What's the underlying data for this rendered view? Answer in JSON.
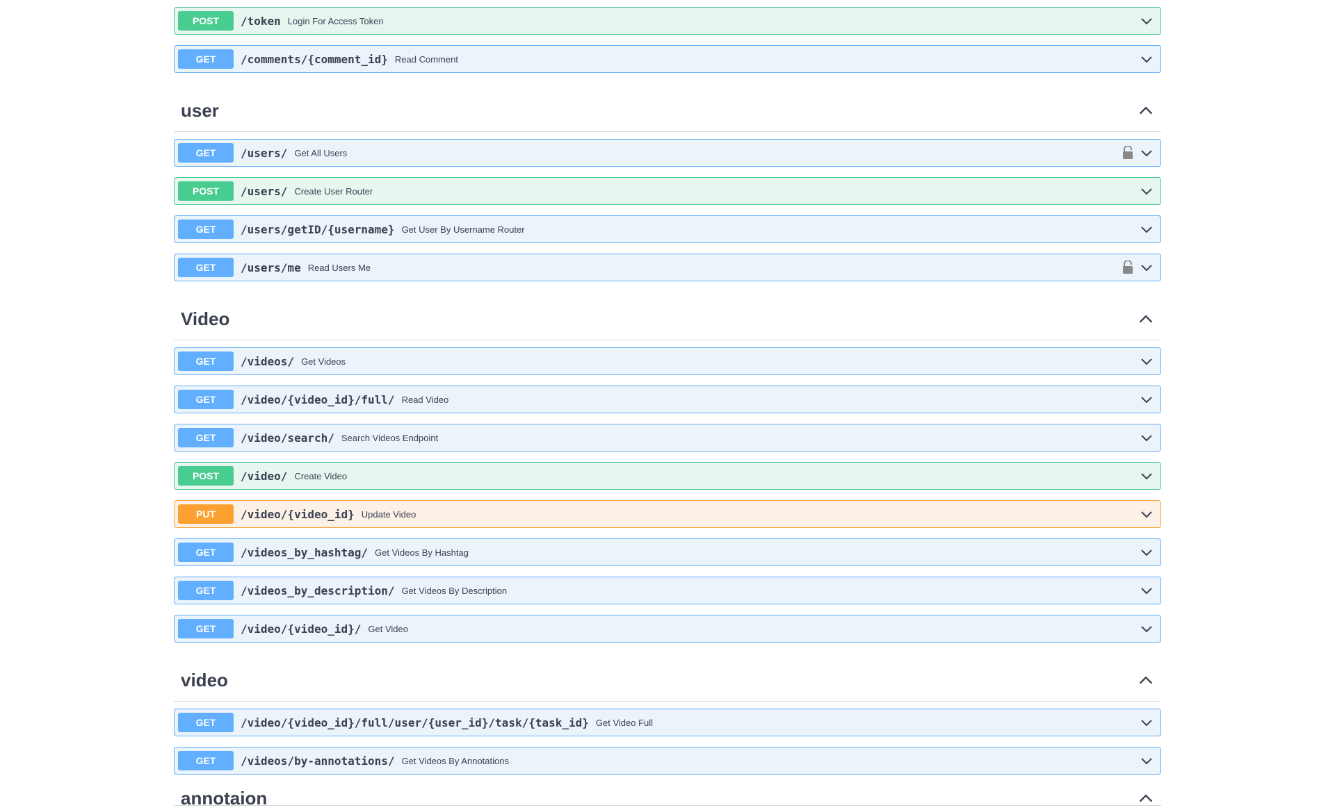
{
  "top_ops": [
    {
      "method": "POST",
      "type": "post",
      "path": "/token",
      "summary": "Login For Access Token",
      "lock": false
    },
    {
      "method": "GET",
      "type": "get",
      "path": "/comments/{comment_id}",
      "summary": "Read Comment",
      "lock": false
    }
  ],
  "sections": [
    {
      "title": "user",
      "ops": [
        {
          "method": "GET",
          "type": "get",
          "path": "/users/",
          "summary": "Get All Users",
          "lock": true
        },
        {
          "method": "POST",
          "type": "post",
          "path": "/users/",
          "summary": "Create User Router",
          "lock": false
        },
        {
          "method": "GET",
          "type": "get",
          "path": "/users/getID/{username}",
          "summary": "Get User By Username Router",
          "lock": false
        },
        {
          "method": "GET",
          "type": "get",
          "path": "/users/me",
          "summary": "Read Users Me",
          "lock": true
        }
      ]
    },
    {
      "title": "Video",
      "ops": [
        {
          "method": "GET",
          "type": "get",
          "path": "/videos/",
          "summary": "Get Videos",
          "lock": false
        },
        {
          "method": "GET",
          "type": "get",
          "path": "/video/{video_id}/full/",
          "summary": "Read Video",
          "lock": false
        },
        {
          "method": "GET",
          "type": "get",
          "path": "/video/search/",
          "summary": "Search Videos Endpoint",
          "lock": false
        },
        {
          "method": "POST",
          "type": "post",
          "path": "/video/",
          "summary": "Create Video",
          "lock": false
        },
        {
          "method": "PUT",
          "type": "put",
          "path": "/video/{video_id}",
          "summary": "Update Video",
          "lock": false
        },
        {
          "method": "GET",
          "type": "get",
          "path": "/videos_by_hashtag/",
          "summary": "Get Videos By Hashtag",
          "lock": false
        },
        {
          "method": "GET",
          "type": "get",
          "path": "/videos_by_description/",
          "summary": "Get Videos By Description",
          "lock": false
        },
        {
          "method": "GET",
          "type": "get",
          "path": "/video/{video_id}/",
          "summary": "Get Video",
          "lock": false
        }
      ]
    },
    {
      "title": "video",
      "ops": [
        {
          "method": "GET",
          "type": "get",
          "path": "/video/{video_id}/full/user/{user_id}/task/{task_id}",
          "summary": "Get Video Full",
          "lock": false
        },
        {
          "method": "GET",
          "type": "get",
          "path": "/videos/by-annotations/",
          "summary": "Get Videos By Annotations",
          "lock": false
        }
      ]
    },
    {
      "title": "annotaion",
      "ops": []
    }
  ],
  "icons": {
    "expand": "chevron-down-icon",
    "collapse": "chevron-up-icon",
    "lock": "lock-icon"
  },
  "colors": {
    "get": "#61affe",
    "post": "#49cc90",
    "put": "#fca130",
    "text": "#3b4151"
  }
}
